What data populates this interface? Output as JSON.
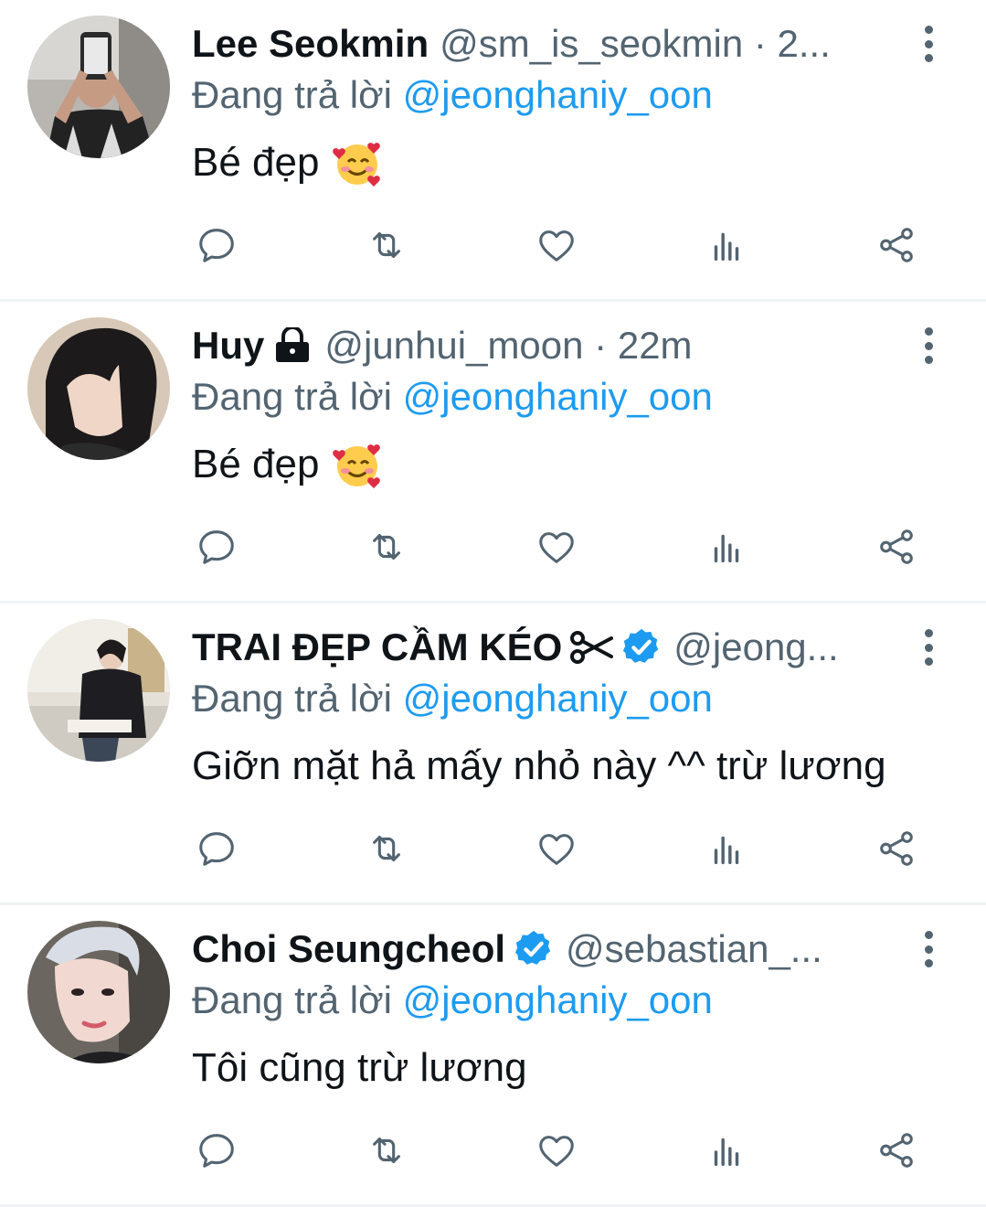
{
  "tweets": [
    {
      "name": "Lee Seokmin",
      "handle_time": "@sm_is_seokmin · 2...",
      "reply_prefix": "Đang trả lời",
      "reply_handle": "@jeonghaniy_oon",
      "text": "Bé đẹp",
      "text_emoji": "smiling-face-with-hearts-icon",
      "badge": "none"
    },
    {
      "name": "Huy",
      "handle_time": "@junhui_moon · 22m",
      "reply_prefix": "Đang trả lời",
      "reply_handle": "@jeonghaniy_oon",
      "text": "Bé đẹp",
      "text_emoji": "smiling-face-with-hearts-icon",
      "badge": "lock-icon"
    },
    {
      "name": "TRAI ĐẸP CẦM KÉO",
      "handle_time": "@jeong...",
      "reply_prefix": "Đang trả lời",
      "reply_handle": "@jeonghaniy_oon",
      "text": "Giỡn mặt hả mấy nhỏ này ^^ trừ lương",
      "badge": "verified-badge-icon",
      "name_emoji": "scissors-icon"
    },
    {
      "name": "Choi Seungcheol",
      "handle_time": "@sebastian_...",
      "reply_prefix": "Đang trả lời",
      "reply_handle": "@jeonghaniy_oon",
      "text": "Tôi cũng trừ lương",
      "badge": "verified-badge-icon"
    }
  ],
  "actions": [
    "reply-icon",
    "retweet-icon",
    "like-icon",
    "views-icon",
    "share-icon"
  ],
  "colors": {
    "accent": "#1d9bf0",
    "secondary_text": "#536471",
    "primary_text": "#0f1419",
    "divider": "#eff3f4"
  }
}
